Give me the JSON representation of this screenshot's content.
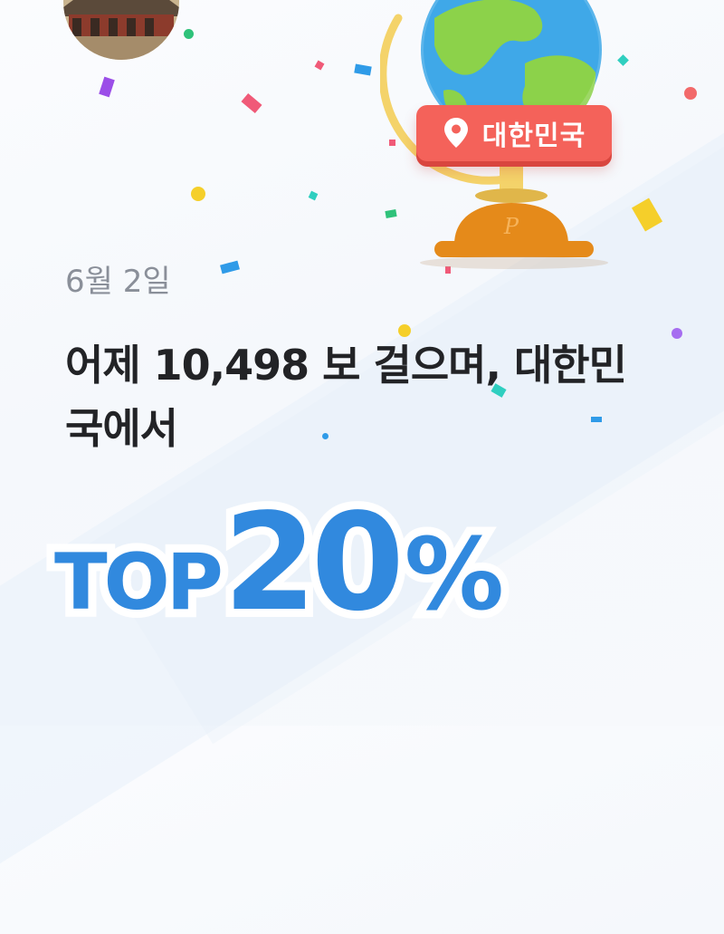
{
  "location": {
    "icon": "location-pin-icon",
    "label": "대한민국"
  },
  "date": "6월 2일",
  "headline": {
    "line1": "어제 10,498 보 걸으며, 대한민",
    "line2": "국에서"
  },
  "rank": {
    "prefix": "TOP",
    "number": "20",
    "suffix": "%"
  },
  "colors": {
    "accent_blue": "#3189de",
    "badge_red": "#f4625a",
    "headline": "#222326",
    "date_gray": "#8a8f99"
  }
}
